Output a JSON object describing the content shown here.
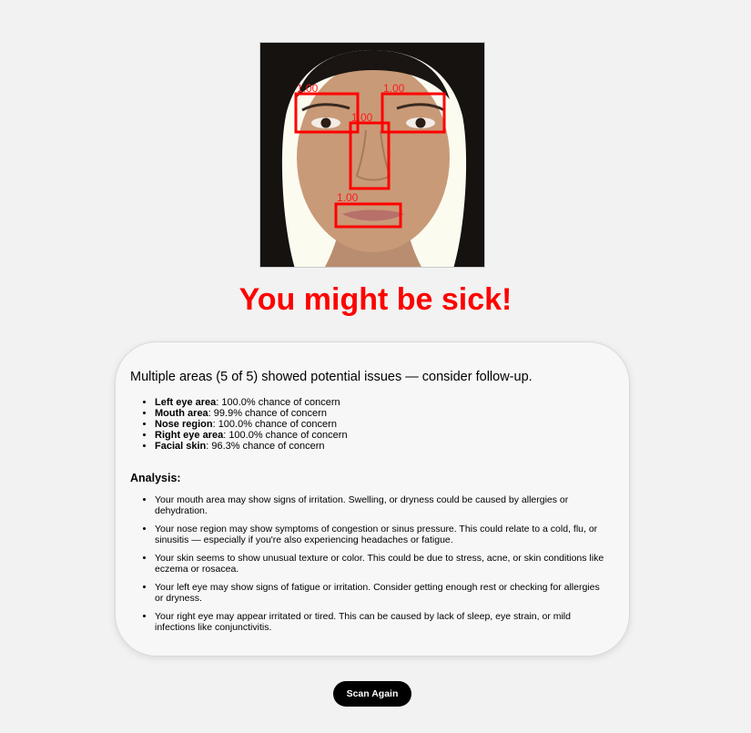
{
  "photo": {
    "detections": [
      {
        "label": "1.00"
      },
      {
        "label": "1.00"
      },
      {
        "label": "1.00"
      },
      {
        "label": "1.00"
      }
    ],
    "box_color": "#ff0000"
  },
  "headline": "You might be sick!",
  "result_card": {
    "summary": "Multiple areas (5 of 5) showed potential issues — consider follow-up.",
    "areas": [
      {
        "name": "Left eye area",
        "detail": ": 100.0% chance of concern"
      },
      {
        "name": "Mouth area",
        "detail": ": 99.9% chance of concern"
      },
      {
        "name": "Nose region",
        "detail": ": 100.0% chance of concern"
      },
      {
        "name": "Right eye area",
        "detail": ": 100.0% chance of concern"
      },
      {
        "name": "Facial skin",
        "detail": ": 96.3% chance of concern"
      }
    ],
    "analysis_title": "Analysis:",
    "analysis": [
      "Your mouth area may show signs of irritation. Swelling, or dryness could be caused by allergies or dehydration.",
      "Your nose region may show symptoms of congestion or sinus pressure. This could relate to a cold, flu, or sinusitis — especially if you're also experiencing headaches or fatigue.",
      "Your skin seems to show unusual texture or color. This could be due to stress, acne, or skin conditions like eczema or rosacea.",
      "Your left eye may show signs of fatigue or irritation. Consider getting enough rest or checking for allergies or dryness.",
      "Your right eye may appear irritated or tired. This can be caused by lack of sleep, eye strain, or mild infections like conjunctivitis."
    ]
  },
  "scan_again_label": "Scan Again",
  "colors": {
    "headline": "#ff0000",
    "button_bg": "#000000",
    "button_text": "#ffffff",
    "page_bg": "#f2f2f2"
  }
}
